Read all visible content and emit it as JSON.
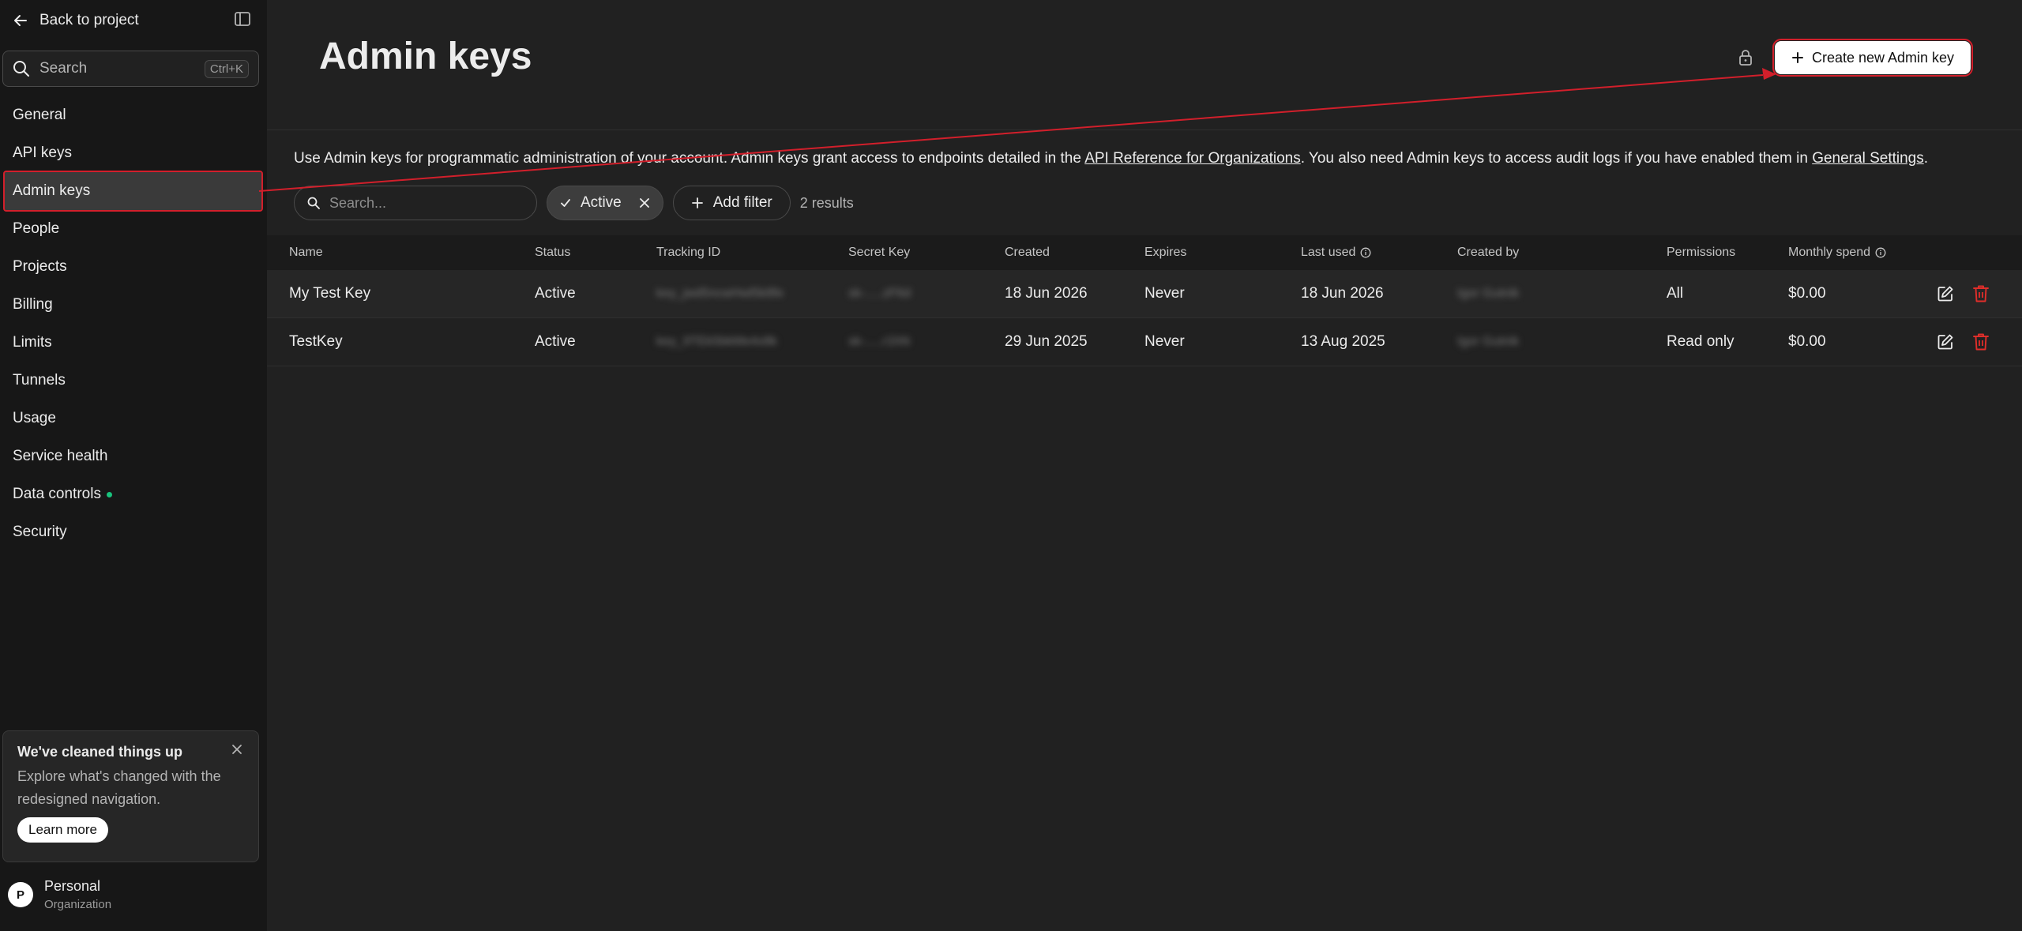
{
  "sidebar": {
    "back_label": "Back to project",
    "search_label": "Search",
    "search_shortcut": "Ctrl+K",
    "items": [
      {
        "label": "General"
      },
      {
        "label": "API keys"
      },
      {
        "label": "Admin keys"
      },
      {
        "label": "People"
      },
      {
        "label": "Projects"
      },
      {
        "label": "Billing"
      },
      {
        "label": "Limits"
      },
      {
        "label": "Tunnels"
      },
      {
        "label": "Usage"
      },
      {
        "label": "Service health"
      },
      {
        "label": "Data controls"
      },
      {
        "label": "Security"
      }
    ],
    "active_item": "Admin keys",
    "notice": {
      "title": "We've cleaned things up",
      "text": "Explore what's changed with the redesigned navigation.",
      "button": "Learn more"
    },
    "org": {
      "avatar_letter": "P",
      "name": "Personal",
      "type": "Organization"
    }
  },
  "header": {
    "title": "Admin keys",
    "create_button": "Create new Admin key"
  },
  "description": {
    "part1": "Use Admin keys for programmatic administration of your account. Admin keys grant access to endpoints detailed in the ",
    "link1": "API Reference for Organizations",
    "part2": ". You also need Admin keys to access audit logs if you have enabled them in ",
    "link2": "General Settings",
    "part3": "."
  },
  "filters": {
    "search_placeholder": "Search...",
    "active_chip": "Active",
    "add_filter": "Add filter",
    "results": "2 results"
  },
  "table": {
    "columns": {
      "name": "Name",
      "status": "Status",
      "tracking_id": "Tracking ID",
      "secret_key": "Secret Key",
      "created": "Created",
      "expires": "Expires",
      "last_used": "Last used",
      "created_by": "Created by",
      "permissions": "Permissions",
      "monthly_spend": "Monthly spend"
    },
    "rows": [
      {
        "name": "My Test Key",
        "status": "Active",
        "tracking_id": "key_jwd5ncwHwl5k8fe",
        "secret_key": "sk-.....zF6d",
        "created": "18 Jun 2026",
        "expires": "Never",
        "last_used": "18 Jun 2026",
        "created_by": "Igor Gutnik",
        "permissions": "All",
        "monthly_spend": "$0.00"
      },
      {
        "name": "TestKey",
        "status": "Active",
        "tracking_id": "key_9TEk5bkMe4x8k",
        "secret_key": "sk-.....r1hN",
        "created": "29 Jun 2025",
        "expires": "Never",
        "last_used": "13 Aug 2025",
        "created_by": "Igor Gutnik",
        "permissions": "Read only",
        "monthly_spend": "$0.00"
      }
    ]
  },
  "colors": {
    "background": "#212121",
    "sidebar": "#171717",
    "annotation_red": "#d21f2b",
    "delete_red": "#e02e2a",
    "status_dot_green": "#19c37d"
  }
}
